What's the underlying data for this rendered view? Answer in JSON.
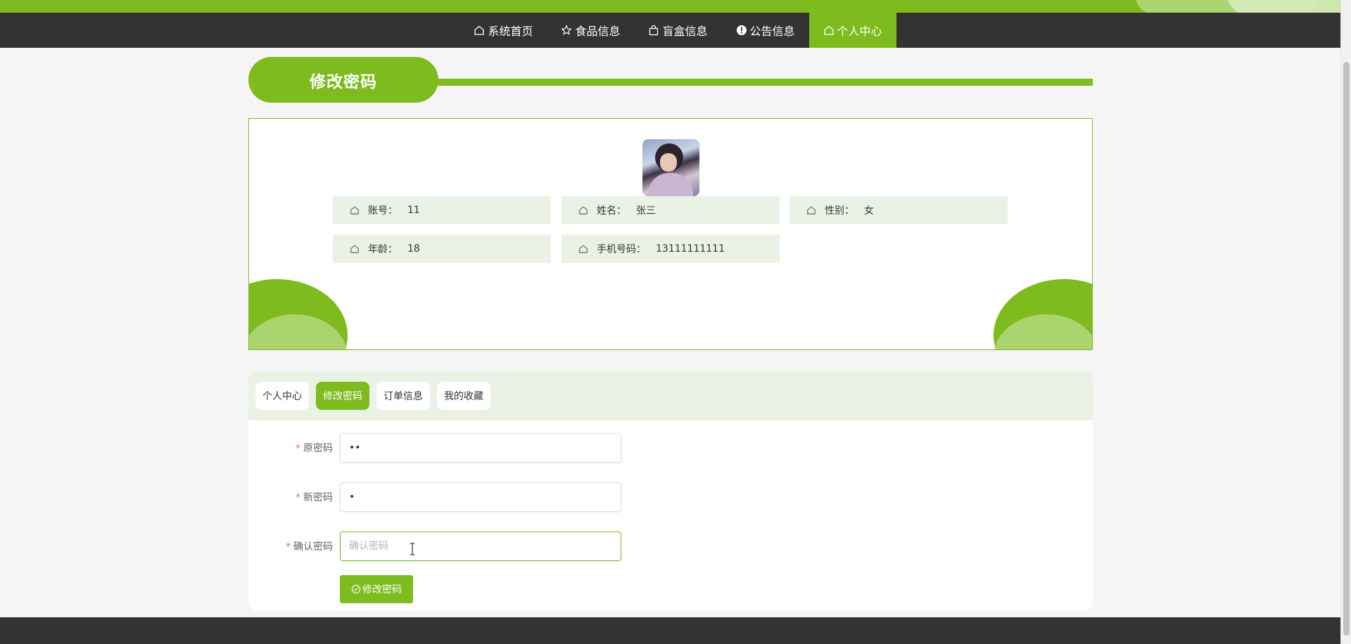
{
  "nav": {
    "items": [
      {
        "label": "系统首页",
        "icon": "house-icon"
      },
      {
        "label": "食品信息",
        "icon": "star-icon"
      },
      {
        "label": "盲盒信息",
        "icon": "bag-icon"
      },
      {
        "label": "公告信息",
        "icon": "alert-icon"
      },
      {
        "label": "个人中心",
        "icon": "house-icon",
        "active": true
      }
    ]
  },
  "page": {
    "title": "修改密码"
  },
  "profile": {
    "account_label": "账号：",
    "account_value": "11",
    "name_label": "姓名：",
    "name_value": "张三",
    "gender_label": "性别：",
    "gender_value": "女",
    "age_label": "年龄：",
    "age_value": "18",
    "phone_label": "手机号码：",
    "phone_value": "13111111111"
  },
  "tabs": [
    {
      "label": "个人中心",
      "active": false
    },
    {
      "label": "修改密码",
      "active": true
    },
    {
      "label": "订单信息",
      "active": false
    },
    {
      "label": "我的收藏",
      "active": false
    }
  ],
  "form": {
    "old_label": "原密码",
    "old_value": "11",
    "new_label": "新密码",
    "new_value": "1",
    "confirm_label": "确认密码",
    "confirm_value": "",
    "confirm_placeholder": "确认密码",
    "required_mark": "*",
    "submit_label": "修改密码"
  },
  "colors": {
    "accent": "#7dbb1f",
    "nav_bg": "#333333",
    "info_bg": "#e9f2e5"
  }
}
